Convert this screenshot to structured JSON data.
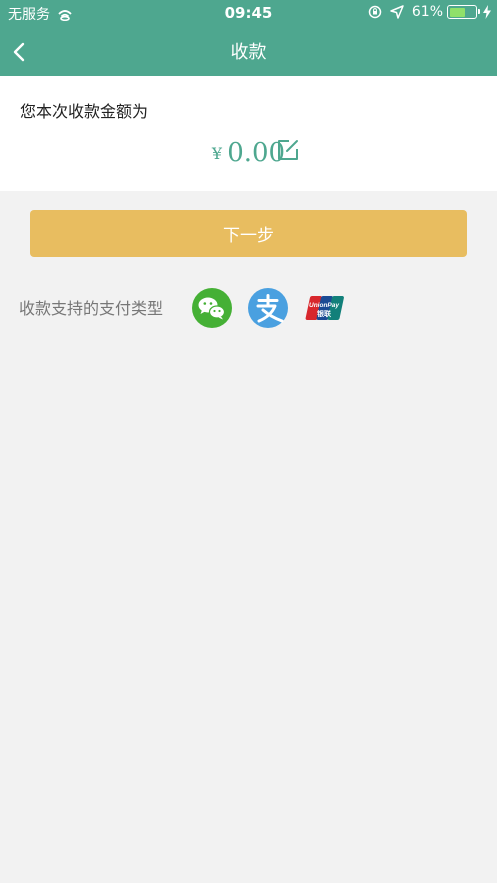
{
  "status_bar": {
    "carrier": "无服务",
    "time": "09:45",
    "battery": "61%",
    "battery_level": 0.61
  },
  "nav": {
    "title": "收款"
  },
  "amount": {
    "label": "您本次收款金额为",
    "currency": "¥",
    "value": "0.00"
  },
  "actions": {
    "next_label": "下一步"
  },
  "payment_types": {
    "label": "收款支持的支付类型",
    "methods": [
      "wechat-pay-icon",
      "alipay-icon",
      "unionpay-icon"
    ]
  },
  "colors": {
    "header": "#4ea78f",
    "button": "#e8bd60",
    "background": "#f2f2f2"
  }
}
